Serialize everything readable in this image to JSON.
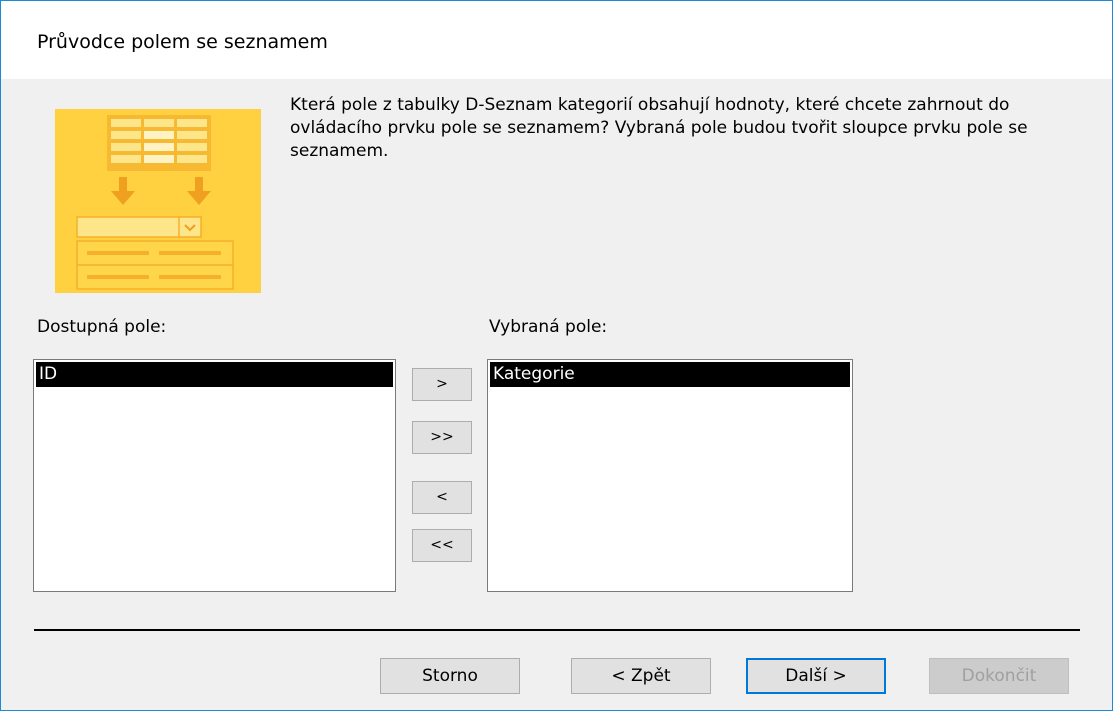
{
  "dialog": {
    "title": "Průvodce polem se seznamem",
    "description": "Která pole z tabulky D-Seznam kategorií obsahují hodnoty, které chcete zahrnout do ovládacího prvku pole se seznamem?  Vybraná pole budou tvořit sloupce prvku pole se seznamem."
  },
  "available": {
    "label": "Dostupná pole:",
    "items": [
      "ID"
    ]
  },
  "selected": {
    "label": "Vybraná pole:",
    "items": [
      "Kategorie"
    ]
  },
  "move_buttons": {
    "add_one": ">",
    "add_all": ">>",
    "remove_one": "<",
    "remove_all": "<<"
  },
  "footer": {
    "cancel": "Storno",
    "back": "< Zpět",
    "next": "Další >",
    "finish": "Dokončit"
  },
  "colors": {
    "accent": "#0078d7",
    "wizard_image": "#ffd54a"
  }
}
